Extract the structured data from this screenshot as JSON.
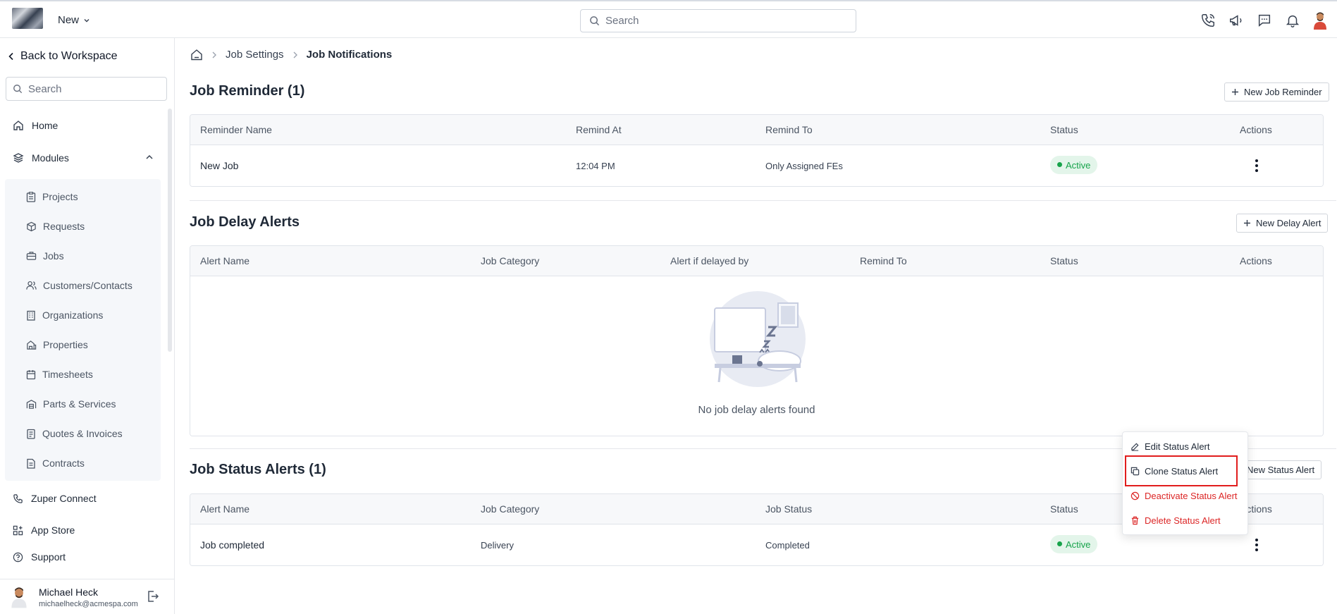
{
  "topbar": {
    "new_label": "New",
    "search_placeholder": "Search",
    "icons": [
      "phone-icon",
      "megaphone-icon",
      "chat-icon",
      "bell-icon",
      "user-avatar"
    ]
  },
  "sidebar": {
    "back_label": "Back to Workspace",
    "search_placeholder": "Search",
    "home_label": "Home",
    "modules_label": "Modules",
    "modules": [
      {
        "label": "Projects",
        "icon": "clipboard-icon"
      },
      {
        "label": "Requests",
        "icon": "package-icon"
      },
      {
        "label": "Jobs",
        "icon": "briefcase-icon"
      },
      {
        "label": "Customers/Contacts",
        "icon": "users-icon"
      },
      {
        "label": "Organizations",
        "icon": "building-icon"
      },
      {
        "label": "Properties",
        "icon": "property-icon"
      },
      {
        "label": "Timesheets",
        "icon": "calendar-icon"
      },
      {
        "label": "Parts & Services",
        "icon": "warehouse-icon"
      },
      {
        "label": "Quotes & Invoices",
        "icon": "receipt-icon"
      },
      {
        "label": "Contracts",
        "icon": "contract-icon"
      }
    ],
    "zuper_connect_label": "Zuper Connect",
    "app_store_label": "App Store",
    "support_label": "Support",
    "user": {
      "name": "Michael Heck",
      "email": "michaelheck@acmespa.com"
    }
  },
  "breadcrumb": {
    "items": [
      "Job Settings",
      "Job Notifications"
    ]
  },
  "reminders": {
    "title": "Job Reminder (1)",
    "new_button": "New Job Reminder",
    "columns": [
      "Reminder Name",
      "Remind At",
      "Remind To",
      "Status",
      "Actions"
    ],
    "rows": [
      {
        "name": "New Job",
        "remind_at": "12:04 PM",
        "remind_to": "Only Assigned FEs",
        "status": "Active"
      }
    ]
  },
  "delay_alerts": {
    "title": "Job Delay Alerts",
    "new_button": "New Delay Alert",
    "columns": [
      "Alert Name",
      "Job Category",
      "Alert if delayed by",
      "Remind To",
      "Status",
      "Actions"
    ],
    "empty_text": "No job delay alerts found"
  },
  "status_alerts": {
    "title": "Job Status Alerts (1)",
    "new_button": "New Status Alert",
    "columns": [
      "Alert Name",
      "Job Category",
      "Job Status",
      "Status",
      "Actions"
    ],
    "rows": [
      {
        "name": "Job completed",
        "category": "Delivery",
        "job_status": "Completed",
        "status": "Active"
      }
    ]
  },
  "context_menu": {
    "items": [
      {
        "label": "Edit Status Alert",
        "icon": "edit-icon"
      },
      {
        "label": "Clone Status Alert",
        "icon": "clone-icon"
      },
      {
        "label": "Deactivate Status Alert",
        "icon": "ban-icon"
      },
      {
        "label": "Delete Status Alert",
        "icon": "trash-icon"
      }
    ]
  },
  "colors": {
    "active_green": "#16a34a",
    "danger_red": "#dc2626",
    "highlight_red": "#e11d1d"
  }
}
